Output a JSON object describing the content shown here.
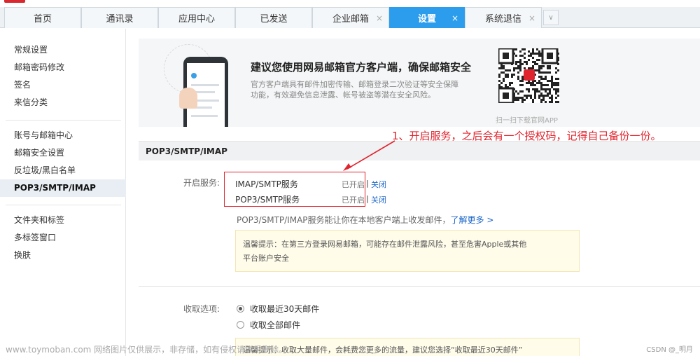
{
  "tabs": [
    {
      "label": "首页",
      "closable": false,
      "active": false
    },
    {
      "label": "通讯录",
      "closable": false,
      "active": false
    },
    {
      "label": "应用中心",
      "closable": false,
      "active": false
    },
    {
      "label": "已发送",
      "closable": false,
      "active": false
    },
    {
      "label": "企业邮箱",
      "closable": true,
      "active": false
    },
    {
      "label": "设置",
      "closable": true,
      "active": true
    },
    {
      "label": "系统退信",
      "closable": true,
      "active": false
    }
  ],
  "tab_close_glyph": "×",
  "tab_more_glyph": "∨",
  "sidebar": {
    "groups": [
      [
        "常规设置",
        "邮箱密码修改",
        "签名",
        "来信分类"
      ],
      [
        "账号与邮箱中心",
        "邮箱安全设置",
        "反垃圾/黑白名单",
        "POP3/SMTP/IMAP"
      ],
      [
        "文件夹和标签",
        "多标签窗口",
        "换肤"
      ]
    ],
    "active": "POP3/SMTP/IMAP"
  },
  "banner": {
    "title": "建议您使用网易邮箱官方客户端，确保邮箱安全",
    "desc": "官方客户端具有邮件加密传输、邮箱登录二次验证等安全保障功能，有效避免信息泄露、帐号被盗等潜在安全风险。",
    "qr_caption": "扫一扫下载官网APP"
  },
  "section_title": "POP3/SMTP/IMAP",
  "annotation": "1、开启服务，之后会有一个授权码，记得自己备份一份。",
  "services": {
    "label": "开启服务:",
    "items": [
      {
        "name": "IMAP/SMTP服务",
        "status": "已开启",
        "sep": "|",
        "action": "关闭"
      },
      {
        "name": "POP3/SMTP服务",
        "status": "已开启",
        "sep": "|",
        "action": "关闭"
      }
    ],
    "desc": "POP3/SMTP/IMAP服务能让你在本地客户端上收发邮件，",
    "more": "了解更多 >"
  },
  "tip1": {
    "line1": "温馨提示：在第三方登录网易邮箱，可能存在邮件泄露风险，甚至危害Apple或其他",
    "line2": "平台账户安全"
  },
  "receive": {
    "label": "收取选项:",
    "options": [
      {
        "label": "收取最近30天邮件",
        "checked": true
      },
      {
        "label": "收取全部邮件",
        "checked": false
      }
    ]
  },
  "tip2": "温馨提示：收取大量邮件，会耗费您更多的流量，建议您选择“收取最近30天邮件”",
  "watermark": "www.toymoban.com 网络图片仅供展示，非存储，如有侵权请联系删除。",
  "credit": "CSDN @_明月",
  "colors": {
    "accent": "#2c9ded",
    "annotation": "#e0242e",
    "link": "#1a66c9"
  }
}
